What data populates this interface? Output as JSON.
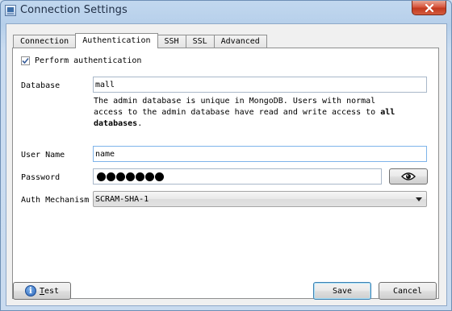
{
  "window": {
    "title": "Connection Settings"
  },
  "tabs": [
    {
      "label": "Connection"
    },
    {
      "label": "Authentication",
      "active": true
    },
    {
      "label": "SSH"
    },
    {
      "label": "SSL"
    },
    {
      "label": "Advanced"
    }
  ],
  "auth": {
    "perform_label": "Perform authentication",
    "perform_checked": true,
    "database_label": "Database",
    "database_value": "mall",
    "help_text_1": "The admin database is unique in MongoDB. Users with normal access to the admin database have read and write access to ",
    "help_text_bold": "all databases",
    "help_text_end": ".",
    "username_label": "User Name",
    "username_value": "name",
    "password_label": "Password",
    "password_length": 7,
    "mechanism_label": "Auth Mechanism",
    "mechanism_value": "SCRAM-SHA-1"
  },
  "buttons": {
    "test_label": "Test",
    "test_mnemonic": "T",
    "test_rest": "est",
    "save_label": "Save",
    "cancel_label": "Cancel"
  },
  "icons": {
    "close": "close-icon",
    "show_password": "eye-icon",
    "info": "info-icon",
    "check": "checkmark-icon"
  }
}
